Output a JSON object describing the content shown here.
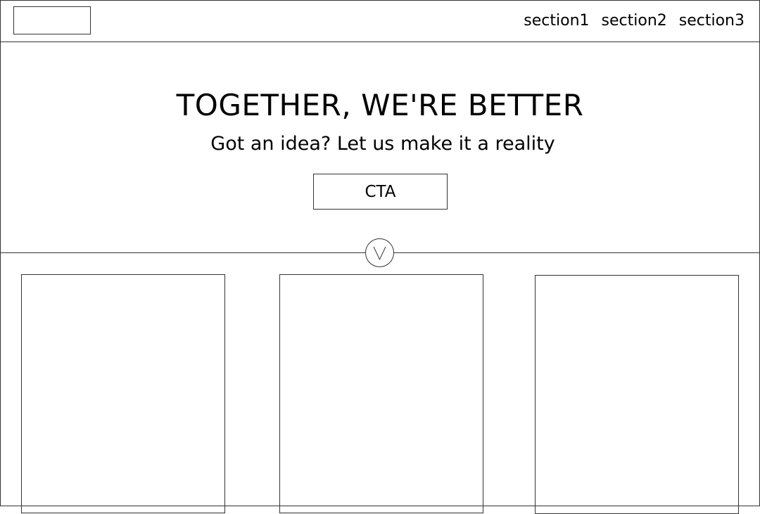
{
  "header": {
    "logo": "logo-placeholder",
    "nav": [
      {
        "label": "section1"
      },
      {
        "label": "section2"
      },
      {
        "label": "section3"
      }
    ]
  },
  "hero": {
    "title": "TOGETHER, WE'RE BETTER",
    "subtitle": "Got an idea? Let us make it a reality",
    "cta_label": "CTA",
    "scroll_icon": "chevron-down-icon"
  },
  "cards": [
    {
      "name": "card-1"
    },
    {
      "name": "card-2"
    },
    {
      "name": "card-3"
    }
  ],
  "colors": {
    "border": "#333333",
    "background": "#ffffff",
    "text": "#000000"
  }
}
